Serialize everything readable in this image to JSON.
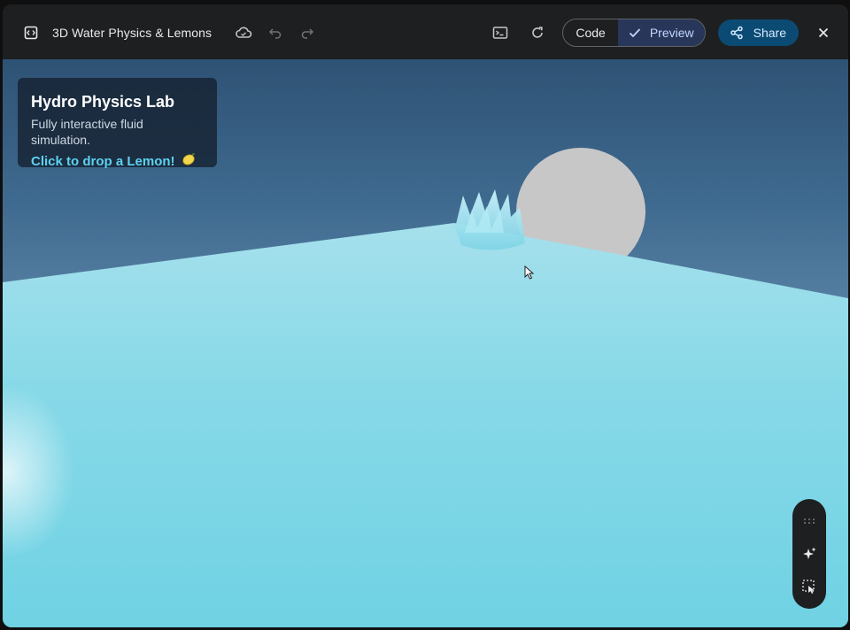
{
  "topbar": {
    "title": "3D Water Physics & Lemons",
    "icons": [
      "code-bracket-icon",
      "cloud-icon",
      "undo-icon",
      "redo-icon",
      "terminal-icon",
      "refresh-icon",
      "check-icon",
      "share-icon",
      "close-icon"
    ],
    "code_label": "Code",
    "preview_label": "Preview",
    "share_label": "Share",
    "active_view": "Preview"
  },
  "overlay": {
    "title": "Hydro Physics Lab",
    "subtitle": "Fully interactive fluid simulation.",
    "cta": "Click to drop a Lemon!",
    "cta_icon": "lemon-icon"
  },
  "floating_toolbar": {
    "icons": [
      "drag-handle-icon",
      "sparkle-icon",
      "select-element-icon"
    ]
  },
  "colors": {
    "accent_blue": "#5ed1f2",
    "share_bg": "#0b4a73",
    "preview_active_bg": "#28365a",
    "water": "#7fd8e6",
    "sky_top": "#2e5274"
  }
}
